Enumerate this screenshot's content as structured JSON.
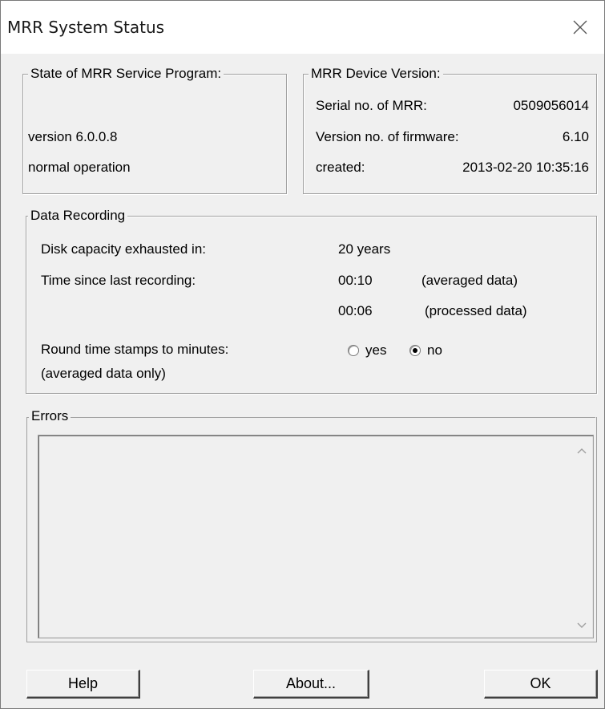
{
  "window": {
    "title": "MRR System Status"
  },
  "service": {
    "legend": "State of MRR Service Program:",
    "version": "version 6.0.0.8",
    "status": "normal operation"
  },
  "device": {
    "legend": "MRR Device Version:",
    "serial_label": "Serial no. of MRR:",
    "serial_value": "0509056014",
    "firmware_label": "Version no. of firmware:",
    "firmware_value": "6.10",
    "created_label": "created:",
    "created_value": "2013-02-20 10:35:16"
  },
  "recording": {
    "legend": "Data Recording",
    "capacity_label": "Disk capacity exhausted in:",
    "capacity_value": "20 years",
    "since_label": "Time since last recording:",
    "averaged_time": "00:10",
    "averaged_label": "(averaged data)",
    "processed_time": "00:06",
    "processed_label": "(processed data)",
    "round_label": "Round time stamps to minutes:",
    "round_note": "(averaged data only)",
    "option_yes": "yes",
    "option_no": "no",
    "selected": "no"
  },
  "errors": {
    "legend": "Errors"
  },
  "buttons": {
    "help": "Help",
    "about": "About...",
    "ok": "OK"
  },
  "icons": {
    "close": "close-icon",
    "scroll_up": "chevron-up-icon",
    "scroll_down": "chevron-down-icon"
  }
}
